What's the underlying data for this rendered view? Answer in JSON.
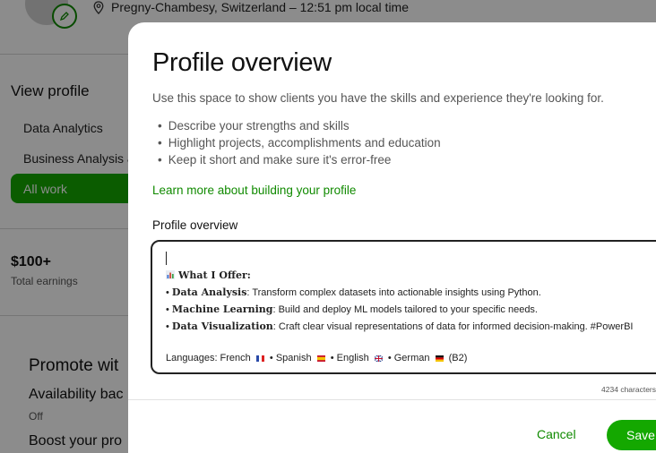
{
  "profile": {
    "location": "Pregny-Chambesy, Switzerland – 12:51 pm local time",
    "view_profile": "View profile",
    "specialties": [
      "Data Analytics",
      "Business Analysis &"
    ],
    "all_work": "All work",
    "earnings_value": "$100+",
    "earnings_label": "Total earnings",
    "promote": "Promote wit",
    "availability": "Availability bac",
    "availability_status": "Off",
    "boost": "Boost your pro"
  },
  "modal": {
    "title": "Profile overview",
    "subtitle": "Use this space to show clients you have the skills and experience they're looking for.",
    "tips": [
      "Describe your strengths and skills",
      "Highlight projects, accomplishments and education",
      "Keep it short and make sure it's error-free"
    ],
    "learn_more": "Learn more about building your profile",
    "field_label": "Profile overview",
    "editor": {
      "heading": "What I Offer:",
      "items": [
        {
          "bold": "Data Analysis",
          "text": ": Transform complex datasets into actionable insights using Python."
        },
        {
          "bold": "Machine Learning",
          "text": ": Build and deploy ML models tailored to your specific needs."
        },
        {
          "bold": "Data Visualization",
          "text": ": Craft clear visual representations of data for informed decision-making. #PowerBI"
        }
      ],
      "languages": {
        "prefix": "Languages: French",
        "spanish": "• Spanish",
        "english": "• English",
        "german": "• German",
        "level": "(B2)"
      }
    },
    "char_count": "4234 characters",
    "cancel": "Cancel",
    "save": "Save"
  }
}
